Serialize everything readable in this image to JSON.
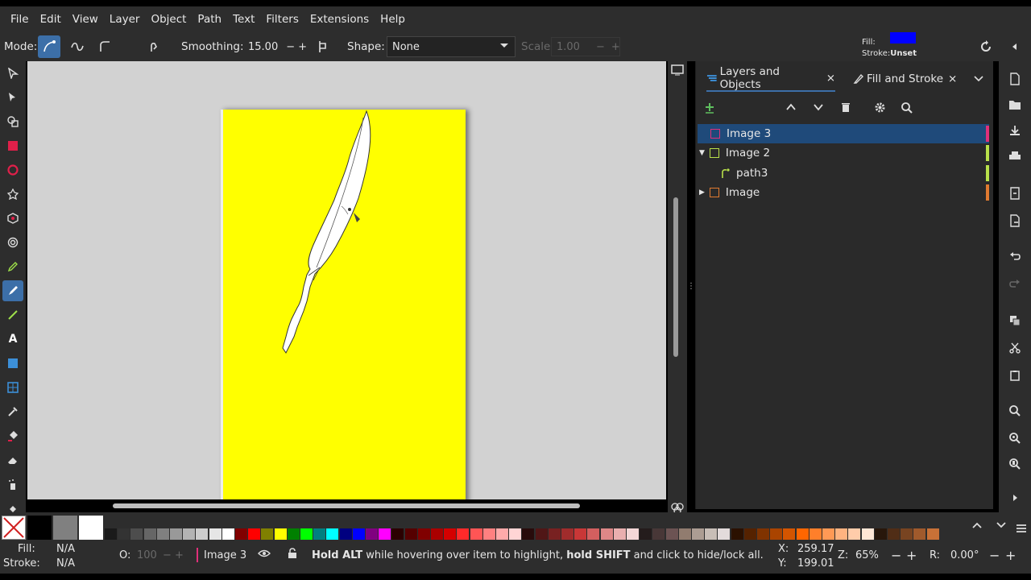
{
  "menu": [
    "File",
    "Edit",
    "View",
    "Layer",
    "Object",
    "Path",
    "Text",
    "Filters",
    "Extensions",
    "Help"
  ],
  "toolbar": {
    "mode_label": "Mode:",
    "smoothing_label": "Smoothing:",
    "smoothing_value": "15.00",
    "shape_label": "Shape:",
    "shape_value": "None",
    "scale_label": "Scale:",
    "scale_value": "1.00",
    "fill_label": "Fill:",
    "fill_color": "#0000ff",
    "stroke_label": "Stroke:",
    "stroke_value": "Unset"
  },
  "dock": {
    "tabs": [
      {
        "label": "Layers and Objects"
      },
      {
        "label": "Fill and Stroke"
      }
    ],
    "layers": [
      {
        "label": "Image 3",
        "selected": true,
        "color": "#e0307a"
      },
      {
        "label": "Image 2",
        "color": "#b8e04a"
      },
      {
        "label": "path3",
        "color": "#b8e04a"
      },
      {
        "label": "Image",
        "color": "#e07a30"
      }
    ]
  },
  "status": {
    "fill_label": "Fill:",
    "fill_value": "N/A",
    "stroke_label": "Stroke:",
    "stroke_value": "N/A",
    "opacity_label": "O:",
    "opacity_value": "100",
    "layer_name": "Image 3",
    "message_pre": "Hold ALT",
    "message_mid1": " while hovering over item to highlight, ",
    "message_bold2": "hold SHIFT",
    "message_post": " and click to hide/lock all.",
    "x_label": "X:",
    "x_value": "259.17",
    "y_label": "Y:",
    "y_value": "199.01",
    "zoom_label": "Z:",
    "zoom_value": "65%",
    "rotate_label": "R:",
    "rotate_value": "0.00°"
  },
  "colors": {
    "page": "#ffff00",
    "accent": "#3c6fa8"
  }
}
